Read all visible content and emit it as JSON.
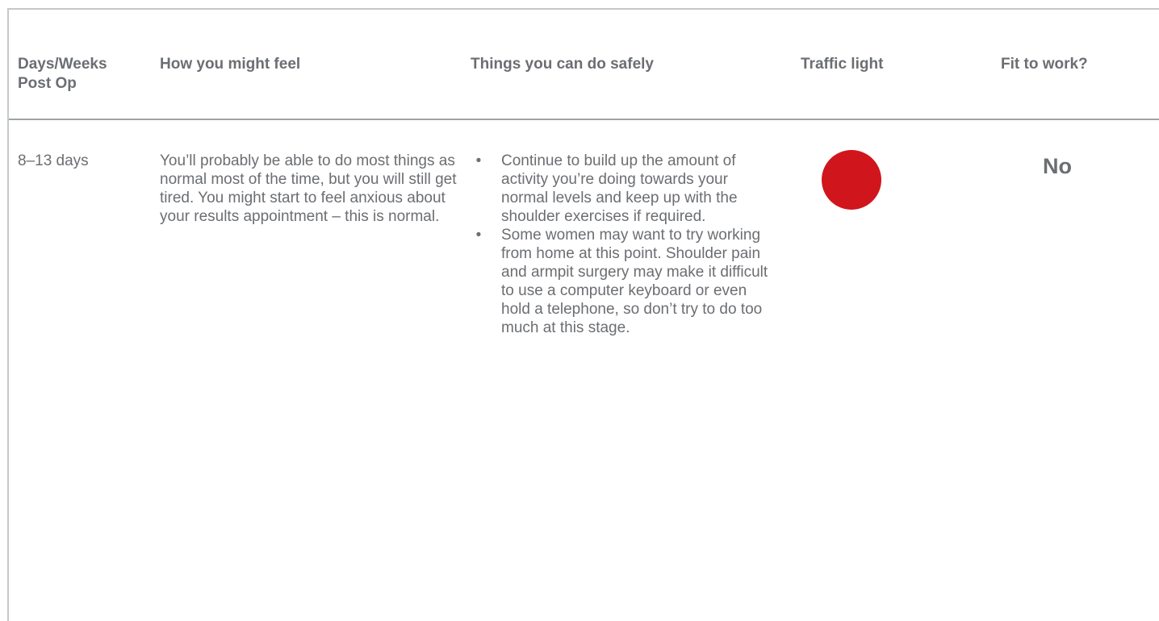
{
  "table": {
    "headers": {
      "days": "Days/Weeks Post Op",
      "feel": "How you might feel",
      "safe": "Things you can do safely",
      "light": "Traffic light",
      "fit": "Fit to work?"
    },
    "row": {
      "days": "8–13 days",
      "feel": "You’ll probably be able to do most things as normal most of the time, but you will still get tired. You might start to feel anxious about your results appointment – this is normal.",
      "safe": [
        "Continue to build up the amount of activity you’re doing towards your normal levels and keep up with the shoulder exercises if required.",
        "Some women may want to try working from home at this point. Shoulder pain and armpit surgery may make it difficult to use a computer keyboard or even hold a telephone, so don’t try to do too much at this stage."
      ],
      "bullet": "•",
      "traffic_light": {
        "status": "red",
        "color": "#d0161c"
      },
      "fit": "No"
    }
  },
  "colors": {
    "text": "#6b6e72",
    "rule": "#9ea2a6",
    "border": "#c4c8cc"
  }
}
